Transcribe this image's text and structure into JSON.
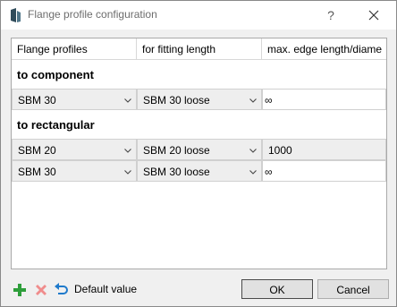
{
  "window": {
    "title": "Flange profile configuration",
    "help_glyph": "?"
  },
  "table": {
    "headers": [
      "Flange profiles",
      "for fitting length",
      "max. edge length/diame"
    ],
    "groups": [
      {
        "title": "to component",
        "rows": [
          {
            "profile": "SBM 30",
            "fitting": "SBM 30 loose",
            "max": "∞",
            "max_editable": true
          }
        ]
      },
      {
        "title": "to rectangular",
        "rows": [
          {
            "profile": "SBM 20",
            "fitting": "SBM 20 loose",
            "max": "1000",
            "max_editable": false
          },
          {
            "profile": "SBM 30",
            "fitting": "SBM 30 loose",
            "max": "∞",
            "max_editable": true
          }
        ]
      }
    ]
  },
  "toolbar": {
    "add_icon": "plus-icon",
    "remove_icon": "delete-x-icon",
    "default_icon": "undo-arrow-icon",
    "default_label": "Default value"
  },
  "buttons": {
    "ok": "OK",
    "cancel": "Cancel"
  },
  "colors": {
    "add": "#2e9e3b",
    "remove": "#f08c8c",
    "default": "#1f7acb"
  }
}
